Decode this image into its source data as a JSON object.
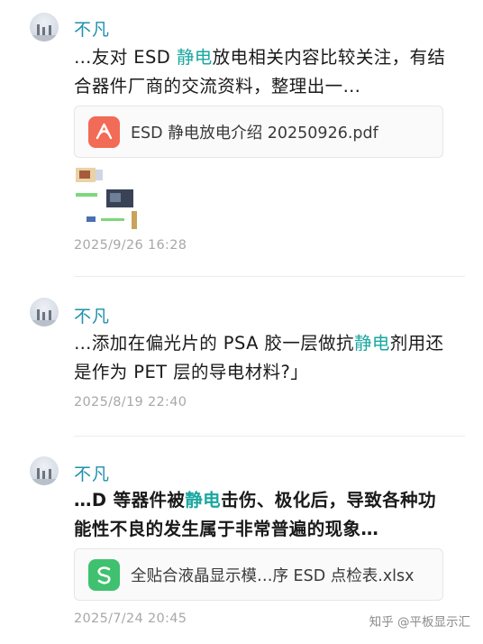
{
  "messages": [
    {
      "name": "不凡",
      "text_before": "…友对 ESD ",
      "highlight": "静电",
      "text_after": "放电相关内容比较关注，有结合器件厂商的交流资料，整理出一…",
      "file": {
        "name": "ESD 静电放电介绍 20250926.pdf",
        "type": "pdf"
      },
      "time": "2025/9/26 16:28"
    },
    {
      "name": "不凡",
      "text_before": "…添加在偏光片的 PSA 胶一层做抗",
      "highlight": "静电",
      "text_after": "剂用还是作为 PET 层的导电材料?」",
      "time": "2025/8/19 22:40"
    },
    {
      "name": "不凡",
      "text_before": "…D 等器件被",
      "highlight": "静电",
      "text_after": "击伤、极化后，导致各种功能性不良的发生属于非常普遍的现象…",
      "file": {
        "name": "全贴合液晶显示模…序 ESD 点检表.xlsx",
        "type": "xlsx"
      },
      "time": "2025/7/24 20:45"
    }
  ],
  "watermark": "知乎 @平板显示汇",
  "colors": {
    "name": "#1f8fae",
    "highlight": "#1aa7a0",
    "pdf": "#f26b56",
    "xlsx": "#3fc16f",
    "time": "#a8a8a8"
  },
  "icons": {
    "pdf": "pdf-file-icon",
    "xlsx": "spreadsheet-file-icon"
  }
}
